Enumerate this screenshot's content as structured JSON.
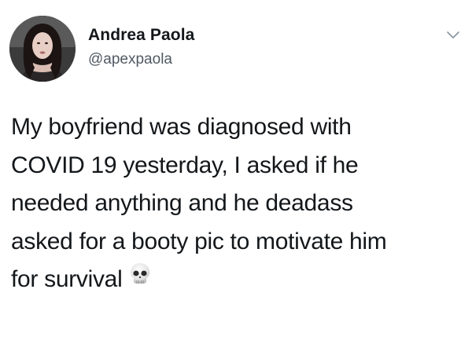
{
  "tweet": {
    "author": {
      "display_name": "Andrea Paola",
      "handle": "@apexpaola"
    },
    "text_lines": [
      "My boyfriend was diagnosed with",
      "COVID 19 yesterday, I asked if he",
      "needed anything and he deadass",
      "asked for a booty pic to motivate him",
      "for survival"
    ],
    "emoji": "skull-emoji",
    "menu_icon": "chevron-down-icon"
  },
  "colors": {
    "text": "#14171a",
    "secondary_text": "#505a63",
    "chevron": "#8a959e",
    "background": "#ffffff"
  }
}
